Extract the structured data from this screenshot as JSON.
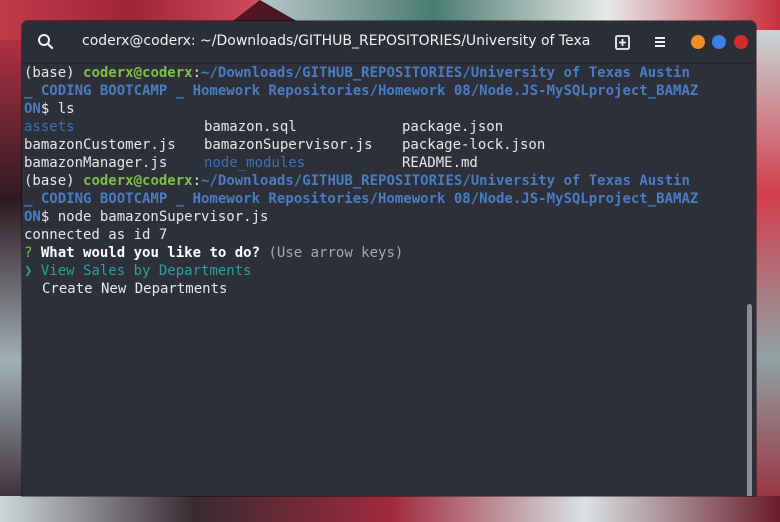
{
  "window": {
    "title": "coderx@coderx: ~/Downloads/GITHUB_REPOSITORIES/University of Texa...",
    "controls": [
      "search-icon",
      "new-tab-icon",
      "menu-icon",
      "minimize",
      "maximize",
      "close"
    ],
    "control_colors": {
      "minimize": "#f28c28",
      "maximize": "#3f7de8",
      "close": "#d62b2b"
    }
  },
  "terminal": {
    "prompt1": {
      "env": "(base) ",
      "user": "coderx@coderx",
      "colon": ":",
      "path_line1": "~/Downloads/GITHUB_REPOSITORIES/University of Texas Austin",
      "path_line2": "_ CODING BOOTCAMP _ Homework Repositories/Homework 08/Node.JS-MySQLproject_BAMAZ",
      "path_line3": "ON",
      "command": "$ ls"
    },
    "ls_output": [
      [
        "assets",
        "bamazon.sql",
        "package.json"
      ],
      [
        "bamazonCustomer.js",
        "bamazonSupervisor.js",
        "package-lock.json"
      ],
      [
        "bamazonManager.js",
        "node_modules",
        "README.md"
      ]
    ],
    "prompt2": {
      "env": "(base) ",
      "user": "coderx@coderx",
      "colon": ":",
      "path_line1": "~/Downloads/GITHUB_REPOSITORIES/University of Texas Austin",
      "path_line2": "_ CODING BOOTCAMP _ Homework Repositories/Homework 08/Node.JS-MySQLproject_BAMAZ",
      "path_line3": "ON",
      "command": "$ node bamazonSupervisor.js"
    },
    "connected": "connected as id 7",
    "question_mark": "?",
    "question": "What would you like to do?",
    "hint": "(Use arrow keys)",
    "pointer": "❯",
    "options": [
      "View Sales by Departments",
      "Create New Departments"
    ],
    "selected_index": 0,
    "colors": {
      "prompt_user": "#7fc242",
      "path": "#4a7cc3",
      "selected": "#2aa198",
      "background": "#2d3038"
    }
  }
}
